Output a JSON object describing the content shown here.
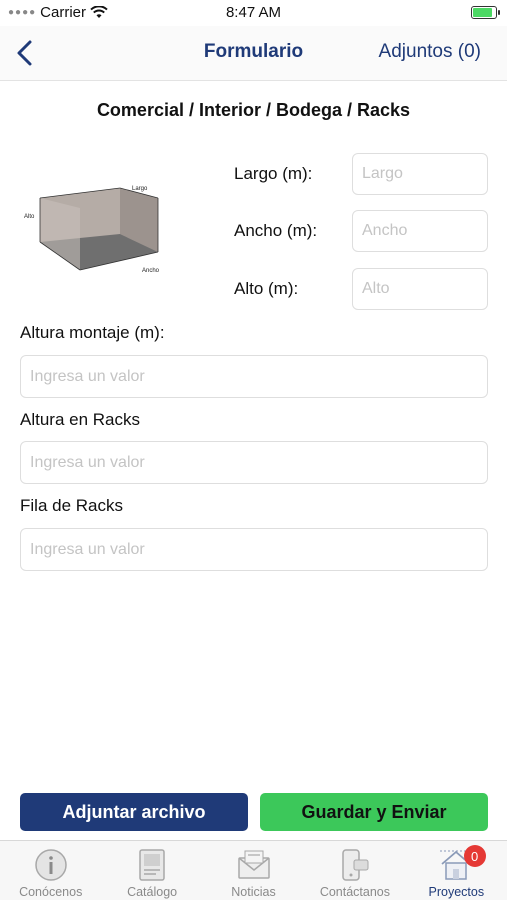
{
  "status_bar": {
    "carrier": "Carrier",
    "time": "8:47 AM"
  },
  "nav": {
    "title": "Formulario",
    "attachments": "Adjuntos (0)"
  },
  "section_title": "Comercial / Interior / Bodega / Racks",
  "room_image": {
    "labels": {
      "length": "Largo",
      "height": "Alto",
      "width": "Ancho"
    }
  },
  "dimensions": [
    {
      "label": "Largo (m):",
      "placeholder": "Largo",
      "value": ""
    },
    {
      "label": "Ancho (m):",
      "placeholder": "Ancho",
      "value": ""
    },
    {
      "label": "Alto (m):",
      "placeholder": "Alto",
      "value": ""
    }
  ],
  "fields": [
    {
      "label": "Altura montaje (m):",
      "placeholder": "Ingresa un valor",
      "value": ""
    },
    {
      "label": "Altura en Racks",
      "placeholder": "Ingresa un valor",
      "value": ""
    },
    {
      "label": "Fila de Racks",
      "placeholder": "Ingresa un valor",
      "value": ""
    }
  ],
  "buttons": {
    "attach": "Adjuntar archivo",
    "save": "Guardar y Enviar"
  },
  "tabs": [
    {
      "label": "Conócenos",
      "icon": "info-icon"
    },
    {
      "label": "Catálogo",
      "icon": "catalog-icon"
    },
    {
      "label": "Noticias",
      "icon": "news-icon"
    },
    {
      "label": "Contáctanos",
      "icon": "contact-icon"
    },
    {
      "label": "Proyectos",
      "icon": "house-icon",
      "active": true,
      "badge": "0"
    }
  ],
  "colors": {
    "brand_blue": "#1f3a78",
    "brand_green": "#3cc85a",
    "badge_red": "#e53935"
  }
}
